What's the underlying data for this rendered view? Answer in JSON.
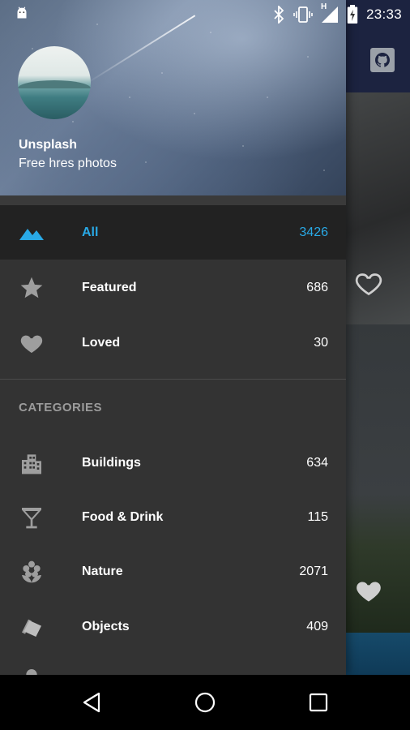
{
  "status_bar": {
    "time": "23:33",
    "network_label": "H",
    "icons": [
      "android-icon",
      "bluetooth-icon",
      "vibrate-icon",
      "signal-icon",
      "battery-charging-icon"
    ]
  },
  "drawer": {
    "header": {
      "title": "Unsplash",
      "subtitle": "Free hres photos"
    },
    "items": [
      {
        "label": "All",
        "count": "3426",
        "icon": "mountain-icon",
        "active": true
      },
      {
        "label": "Featured",
        "count": "686",
        "icon": "star-icon",
        "active": false
      },
      {
        "label": "Loved",
        "count": "30",
        "icon": "heart-icon",
        "active": false
      }
    ],
    "categories_header": "CATEGORIES",
    "categories": [
      {
        "label": "Buildings",
        "count": "634",
        "icon": "building-icon"
      },
      {
        "label": "Food & Drink",
        "count": "115",
        "icon": "cocktail-icon"
      },
      {
        "label": "Nature",
        "count": "2071",
        "icon": "flower-icon"
      },
      {
        "label": "Objects",
        "count": "409",
        "icon": "objects-icon"
      }
    ]
  },
  "colors": {
    "accent": "#29a9e6",
    "drawer_bg": "#333333",
    "active_bg": "#222222",
    "toolbar_bg": "#1c2340"
  },
  "nav_bar": {
    "buttons": [
      "back-icon",
      "home-icon",
      "recents-icon"
    ]
  }
}
